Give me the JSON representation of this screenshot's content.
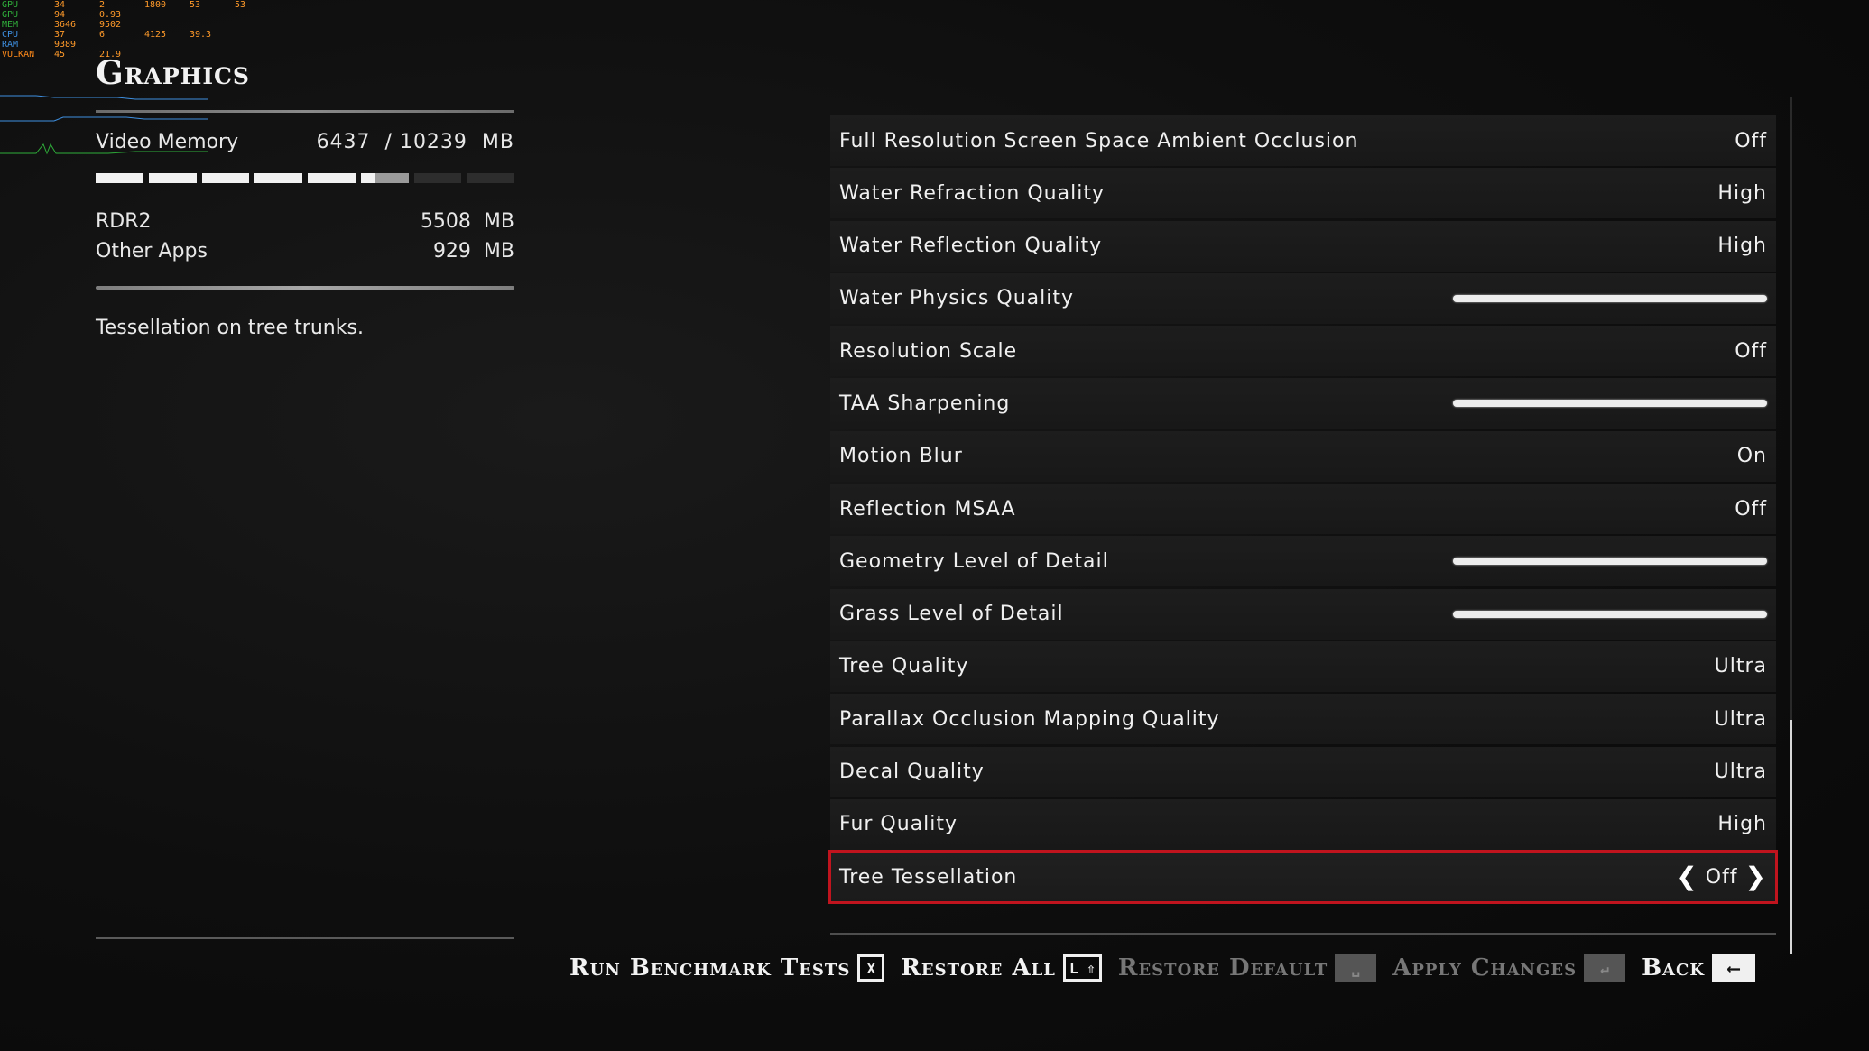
{
  "hud": {
    "rows": [
      {
        "label": "GPU",
        "c1": "34",
        "c2": "2",
        "c3": "1800",
        "c4": "53",
        "c5": "53",
        "cls": "g"
      },
      {
        "label": "GPU",
        "c1": "94",
        "c2": "0.93",
        "c3": "",
        "c4": "",
        "c5": "",
        "cls": "g"
      },
      {
        "label": "MEM",
        "c1": "3646",
        "c2": "9502",
        "c3": "",
        "c4": "",
        "c5": "",
        "cls": "g"
      },
      {
        "label": "CPU",
        "c1": "37",
        "c2": "6",
        "c3": "4125",
        "c4": "39.3",
        "c5": "",
        "cls": "b"
      },
      {
        "label": "RAM",
        "c1": "9389",
        "c2": "",
        "c3": "",
        "c4": "",
        "c5": "",
        "cls": "b"
      },
      {
        "label": "VULKAN",
        "c1": "45",
        "c2": "21.9",
        "c3": "",
        "c4": "",
        "c5": "",
        "cls": "o"
      }
    ]
  },
  "left": {
    "title": "Graphics",
    "video_memory_label": "Video Memory",
    "video_memory_value": "6437  / 10239  MB",
    "memory_fraction": 0.629,
    "apps": [
      {
        "name": "RDR2",
        "value": "5508  MB"
      },
      {
        "name": "Other Apps",
        "value": "929  MB"
      }
    ],
    "description": "Tessellation on tree trunks."
  },
  "settings": [
    {
      "label": "Full Resolution Screen Space Ambient Occlusion",
      "value": "Off",
      "kind": "text"
    },
    {
      "label": "Water Refraction Quality",
      "value": "High",
      "kind": "text"
    },
    {
      "label": "Water Reflection Quality",
      "value": "High",
      "kind": "text"
    },
    {
      "label": "Water Physics Quality",
      "value": "",
      "kind": "slider"
    },
    {
      "label": "Resolution Scale",
      "value": "Off",
      "kind": "text"
    },
    {
      "label": "TAA Sharpening",
      "value": "",
      "kind": "slider"
    },
    {
      "label": "Motion Blur",
      "value": "On",
      "kind": "text"
    },
    {
      "label": "Reflection MSAA",
      "value": "Off",
      "kind": "text"
    },
    {
      "label": "Geometry Level of Detail",
      "value": "",
      "kind": "slider"
    },
    {
      "label": "Grass Level of Detail",
      "value": "",
      "kind": "slider"
    },
    {
      "label": "Tree Quality",
      "value": "Ultra",
      "kind": "text"
    },
    {
      "label": "Parallax Occlusion Mapping Quality",
      "value": "Ultra",
      "kind": "text"
    },
    {
      "label": "Decal Quality",
      "value": "Ultra",
      "kind": "text"
    },
    {
      "label": "Fur Quality",
      "value": "High",
      "kind": "text"
    },
    {
      "label": "Tree Tessellation",
      "value": "Off",
      "kind": "selected"
    }
  ],
  "actions": [
    {
      "label": "Run Benchmark Tests",
      "key": "X",
      "dim": false
    },
    {
      "label": "Restore All",
      "key": "L ⇧",
      "dim": false
    },
    {
      "label": "Restore Default",
      "key": "␣",
      "dim": true
    },
    {
      "label": "Apply Changes",
      "key": "↵",
      "dim": true
    },
    {
      "label": "Back",
      "key": "⟵",
      "dim": false
    }
  ],
  "colors": {
    "selection_outline": "#c0141e",
    "slider": "#ededed"
  }
}
